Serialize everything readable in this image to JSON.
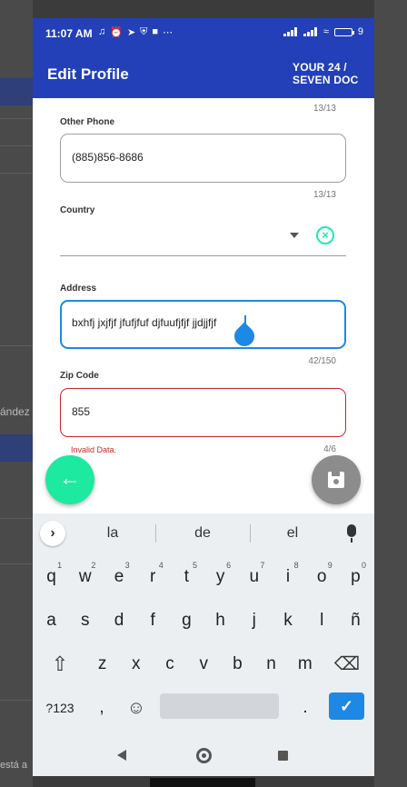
{
  "background": {
    "left_text": "ández",
    "left_text_bottom": "está a"
  },
  "status_bar": {
    "time": "11:07 AM",
    "left_icons": [
      "mute-icon",
      "alarm-icon",
      "telegram-icon",
      "shield-icon",
      "square-icon",
      "more-icon"
    ],
    "battery_text": "9"
  },
  "app_bar": {
    "title": "Edit Profile",
    "logo_line1": "YOUR 24 /",
    "logo_line2": "SEVEN DOC"
  },
  "form": {
    "top_counter": "13/13",
    "other_phone": {
      "label": "Other Phone",
      "value": "(885)856-8686",
      "counter": "13/13"
    },
    "country": {
      "label": "Country",
      "value": ""
    },
    "address": {
      "label": "Address",
      "value": "bxhfj jxjfjf jfufjfuf djfuufjfjf jjdjjfjf",
      "counter": "42/150"
    },
    "zip_code": {
      "label": "Zip Code",
      "value": "855",
      "error": "Invalid Data.",
      "counter": "4/6"
    }
  },
  "keyboard": {
    "suggestions": [
      "la",
      "de",
      "el"
    ],
    "row1": [
      {
        "k": "q",
        "n": "1"
      },
      {
        "k": "w",
        "n": "2"
      },
      {
        "k": "e",
        "n": "3"
      },
      {
        "k": "r",
        "n": "4"
      },
      {
        "k": "t",
        "n": "5"
      },
      {
        "k": "y",
        "n": "6"
      },
      {
        "k": "u",
        "n": "7"
      },
      {
        "k": "i",
        "n": "8"
      },
      {
        "k": "o",
        "n": "9"
      },
      {
        "k": "p",
        "n": "0"
      }
    ],
    "row2": [
      "a",
      "s",
      "d",
      "f",
      "g",
      "h",
      "j",
      "k",
      "l",
      "ñ"
    ],
    "row3": [
      "z",
      "x",
      "c",
      "v",
      "b",
      "n",
      "m"
    ],
    "symbols_label": "?123",
    "comma": ",",
    "period": "."
  },
  "colors": {
    "primary": "#2340b8",
    "accent_green": "#1de9a0",
    "focus_blue": "#1e88e5",
    "error_red": "#c62828"
  }
}
